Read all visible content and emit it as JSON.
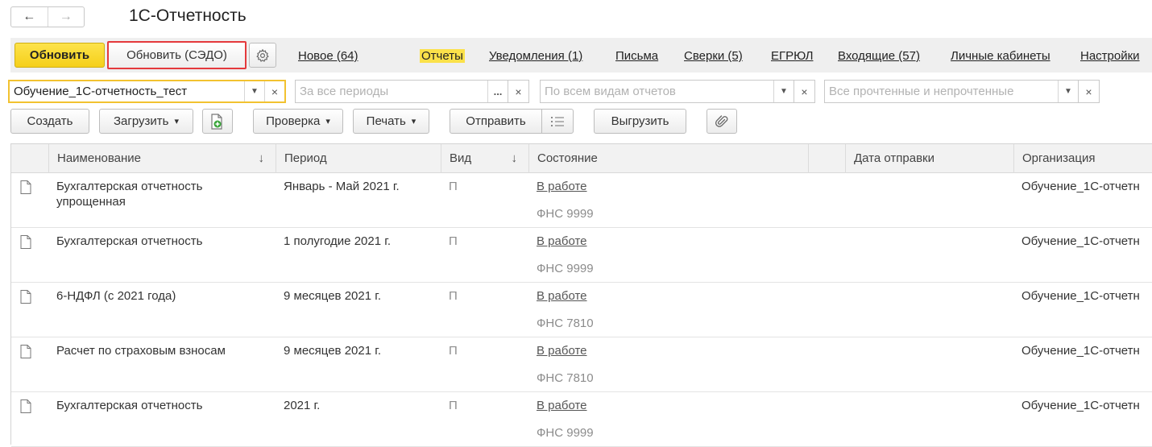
{
  "window": {
    "title": "1С-Отчетность",
    "back_icon": "←",
    "forward_icon": "→"
  },
  "toolbar": {
    "refresh_label": "Обновить",
    "refresh_sedo_label": "Обновить (СЭДО)",
    "settings_icon": "⚙"
  },
  "sections": {
    "new": "Новое (64)",
    "reports": "Отчеты",
    "notifications": "Уведомления (1)",
    "letters": "Письма",
    "reconciliations": "Сверки (5)",
    "egrul": "ЕГРЮЛ",
    "incoming": "Входящие (57)",
    "cabinets": "Личные кабинеты",
    "settings": "Настройки"
  },
  "filters": {
    "organization_value": "Обучение_1С-отчетность_тест",
    "period_placeholder": "За все периоды",
    "report_type_placeholder": "По всем видам отчетов",
    "read_state_placeholder": "Все прочтенные и непрочтенные",
    "dropdown_icon": "▼",
    "choose_icon": "...",
    "clear_icon": "×"
  },
  "actions": {
    "create": "Создать",
    "load": "Загрузить",
    "check": "Проверка",
    "print": "Печать",
    "send": "Отправить",
    "export": "Выгрузить",
    "dropdown_caret": "▾"
  },
  "table": {
    "columns": {
      "name": "Наименование",
      "period": "Период",
      "kind": "Вид",
      "state": "Состояние",
      "sent_date": "Дата отправки",
      "organization": "Организация",
      "sort_icon": "↓"
    },
    "rows": [
      {
        "name": "Бухгалтерская отчетность упрощенная",
        "period": "Январь - Май 2021 г.",
        "kind": "П",
        "state": "В работе",
        "authority": "ФНС 9999",
        "sent_date": "",
        "organization": "Обучение_1С-отчетн"
      },
      {
        "name": "Бухгалтерская отчетность",
        "period": "1 полугодие 2021 г.",
        "kind": "П",
        "state": "В работе",
        "authority": "ФНС 9999",
        "sent_date": "",
        "organization": "Обучение_1С-отчетн"
      },
      {
        "name": "6-НДФЛ (с 2021 года)",
        "period": "9 месяцев 2021 г.",
        "kind": "П",
        "state": "В работе",
        "authority": "ФНС 7810",
        "sent_date": "",
        "organization": "Обучение_1С-отчетн"
      },
      {
        "name": "Расчет по страховым взносам",
        "period": "9 месяцев 2021 г.",
        "kind": "П",
        "state": "В работе",
        "authority": "ФНС 7810",
        "sent_date": "",
        "organization": "Обучение_1С-отчетн"
      },
      {
        "name": "Бухгалтерская отчетность",
        "period": "2021 г.",
        "kind": "П",
        "state": "В работе",
        "authority": "ФНС 9999",
        "sent_date": "",
        "organization": "Обучение_1С-отчетн"
      }
    ]
  },
  "colors": {
    "primary_button": "#f5cf1a",
    "highlight": "#e4393c",
    "active_section": "#fbe14a",
    "focus_border": "#f2c230"
  }
}
